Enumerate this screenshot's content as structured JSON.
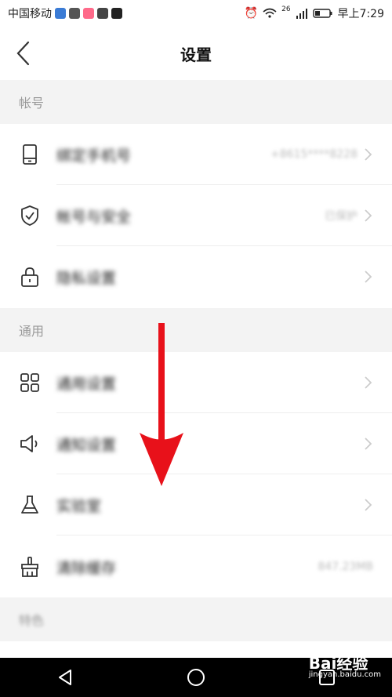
{
  "status_bar": {
    "carrier": "中国移动",
    "network": "26",
    "time_label": "早上7:29"
  },
  "header": {
    "title": "设置"
  },
  "sections": [
    {
      "title": "帐号",
      "items": [
        {
          "label": "绑定手机号",
          "value": "+8615****8228"
        },
        {
          "label": "帐号与安全",
          "value": "已保护"
        },
        {
          "label": "隐私设置",
          "value": ""
        }
      ]
    },
    {
      "title": "通用",
      "items": [
        {
          "label": "通用设置",
          "value": ""
        },
        {
          "label": "通知设置",
          "value": ""
        },
        {
          "label": "实验室",
          "value": ""
        },
        {
          "label": "清除缓存",
          "value": "847.23MB"
        }
      ]
    },
    {
      "title": "特色",
      "items": []
    }
  ],
  "watermark": {
    "text": "Bai经验",
    "url": "jingyan.baidu.com"
  },
  "colors": {
    "arrow": "#e8111a",
    "section_bg": "#f3f3f3"
  }
}
